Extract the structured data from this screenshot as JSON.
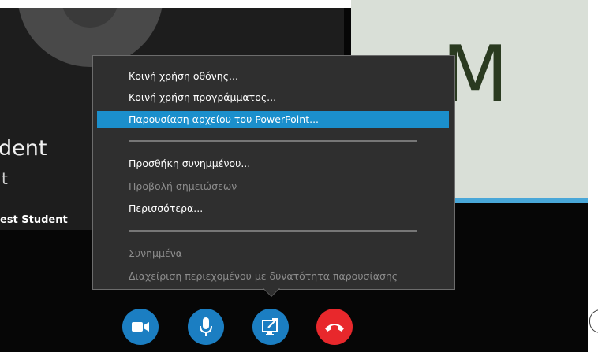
{
  "participants": {
    "left": {
      "name_partial": "dent",
      "subtext_partial": "t",
      "label": "est Student"
    },
    "right": {
      "initial": "M"
    }
  },
  "menu": {
    "items": [
      {
        "label": "Κοινή χρήση οθόνης...",
        "enabled": true
      },
      {
        "label": "Κοινή χρήση προγράμματος...",
        "enabled": true
      },
      {
        "label": "Παρουσίαση αρχείου του PowerPoint...",
        "enabled": true,
        "highlighted": true
      },
      {
        "label": "Προσθήκη συνημμένου...",
        "enabled": true
      },
      {
        "label": "Προβολή σημειώσεων",
        "enabled": false
      },
      {
        "label": "Περισσότερα...",
        "enabled": true
      },
      {
        "label": "Συνημμένα",
        "enabled": false
      },
      {
        "label": "Διαχείριση περιεχομένου με δυνατότητα παρουσίασης",
        "enabled": false
      }
    ]
  },
  "controls": [
    {
      "name": "video",
      "icon": "video-camera-icon",
      "color": "#1b7ec2"
    },
    {
      "name": "microphone",
      "icon": "microphone-icon",
      "color": "#1b7ec2"
    },
    {
      "name": "present",
      "icon": "present-screen-icon",
      "color": "#1b7ec2",
      "active": true
    },
    {
      "name": "hang-up",
      "icon": "hang-up-phone-icon",
      "color": "#e8282c"
    }
  ],
  "colors": {
    "highlight": "#1b8fcc",
    "menu_bg": "#2f2f2f",
    "accent_bar": "#49a7d8"
  }
}
